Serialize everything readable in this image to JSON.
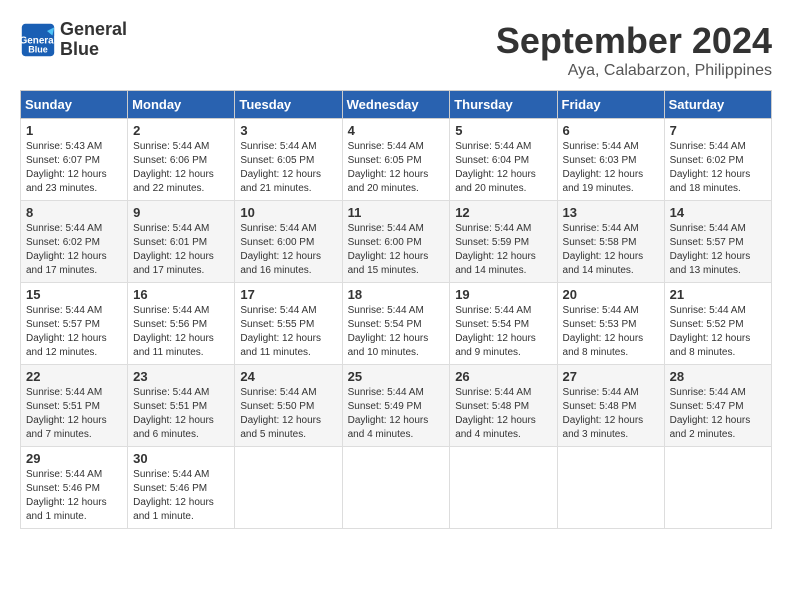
{
  "header": {
    "logo_line1": "General",
    "logo_line2": "Blue",
    "month": "September 2024",
    "location": "Aya, Calabarzon, Philippines"
  },
  "weekdays": [
    "Sunday",
    "Monday",
    "Tuesday",
    "Wednesday",
    "Thursday",
    "Friday",
    "Saturday"
  ],
  "weeks": [
    [
      {
        "day": "1",
        "info": "Sunrise: 5:43 AM\nSunset: 6:07 PM\nDaylight: 12 hours and 23 minutes."
      },
      {
        "day": "2",
        "info": "Sunrise: 5:44 AM\nSunset: 6:06 PM\nDaylight: 12 hours and 22 minutes."
      },
      {
        "day": "3",
        "info": "Sunrise: 5:44 AM\nSunset: 6:05 PM\nDaylight: 12 hours and 21 minutes."
      },
      {
        "day": "4",
        "info": "Sunrise: 5:44 AM\nSunset: 6:05 PM\nDaylight: 12 hours and 20 minutes."
      },
      {
        "day": "5",
        "info": "Sunrise: 5:44 AM\nSunset: 6:04 PM\nDaylight: 12 hours and 20 minutes."
      },
      {
        "day": "6",
        "info": "Sunrise: 5:44 AM\nSunset: 6:03 PM\nDaylight: 12 hours and 19 minutes."
      },
      {
        "day": "7",
        "info": "Sunrise: 5:44 AM\nSunset: 6:02 PM\nDaylight: 12 hours and 18 minutes."
      }
    ],
    [
      {
        "day": "8",
        "info": "Sunrise: 5:44 AM\nSunset: 6:02 PM\nDaylight: 12 hours and 17 minutes."
      },
      {
        "day": "9",
        "info": "Sunrise: 5:44 AM\nSunset: 6:01 PM\nDaylight: 12 hours and 17 minutes."
      },
      {
        "day": "10",
        "info": "Sunrise: 5:44 AM\nSunset: 6:00 PM\nDaylight: 12 hours and 16 minutes."
      },
      {
        "day": "11",
        "info": "Sunrise: 5:44 AM\nSunset: 6:00 PM\nDaylight: 12 hours and 15 minutes."
      },
      {
        "day": "12",
        "info": "Sunrise: 5:44 AM\nSunset: 5:59 PM\nDaylight: 12 hours and 14 minutes."
      },
      {
        "day": "13",
        "info": "Sunrise: 5:44 AM\nSunset: 5:58 PM\nDaylight: 12 hours and 14 minutes."
      },
      {
        "day": "14",
        "info": "Sunrise: 5:44 AM\nSunset: 5:57 PM\nDaylight: 12 hours and 13 minutes."
      }
    ],
    [
      {
        "day": "15",
        "info": "Sunrise: 5:44 AM\nSunset: 5:57 PM\nDaylight: 12 hours and 12 minutes."
      },
      {
        "day": "16",
        "info": "Sunrise: 5:44 AM\nSunset: 5:56 PM\nDaylight: 12 hours and 11 minutes."
      },
      {
        "day": "17",
        "info": "Sunrise: 5:44 AM\nSunset: 5:55 PM\nDaylight: 12 hours and 11 minutes."
      },
      {
        "day": "18",
        "info": "Sunrise: 5:44 AM\nSunset: 5:54 PM\nDaylight: 12 hours and 10 minutes."
      },
      {
        "day": "19",
        "info": "Sunrise: 5:44 AM\nSunset: 5:54 PM\nDaylight: 12 hours and 9 minutes."
      },
      {
        "day": "20",
        "info": "Sunrise: 5:44 AM\nSunset: 5:53 PM\nDaylight: 12 hours and 8 minutes."
      },
      {
        "day": "21",
        "info": "Sunrise: 5:44 AM\nSunset: 5:52 PM\nDaylight: 12 hours and 8 minutes."
      }
    ],
    [
      {
        "day": "22",
        "info": "Sunrise: 5:44 AM\nSunset: 5:51 PM\nDaylight: 12 hours and 7 minutes."
      },
      {
        "day": "23",
        "info": "Sunrise: 5:44 AM\nSunset: 5:51 PM\nDaylight: 12 hours and 6 minutes."
      },
      {
        "day": "24",
        "info": "Sunrise: 5:44 AM\nSunset: 5:50 PM\nDaylight: 12 hours and 5 minutes."
      },
      {
        "day": "25",
        "info": "Sunrise: 5:44 AM\nSunset: 5:49 PM\nDaylight: 12 hours and 4 minutes."
      },
      {
        "day": "26",
        "info": "Sunrise: 5:44 AM\nSunset: 5:48 PM\nDaylight: 12 hours and 4 minutes."
      },
      {
        "day": "27",
        "info": "Sunrise: 5:44 AM\nSunset: 5:48 PM\nDaylight: 12 hours and 3 minutes."
      },
      {
        "day": "28",
        "info": "Sunrise: 5:44 AM\nSunset: 5:47 PM\nDaylight: 12 hours and 2 minutes."
      }
    ],
    [
      {
        "day": "29",
        "info": "Sunrise: 5:44 AM\nSunset: 5:46 PM\nDaylight: 12 hours and 1 minute."
      },
      {
        "day": "30",
        "info": "Sunrise: 5:44 AM\nSunset: 5:46 PM\nDaylight: 12 hours and 1 minute."
      },
      {
        "day": "",
        "info": ""
      },
      {
        "day": "",
        "info": ""
      },
      {
        "day": "",
        "info": ""
      },
      {
        "day": "",
        "info": ""
      },
      {
        "day": "",
        "info": ""
      }
    ]
  ]
}
